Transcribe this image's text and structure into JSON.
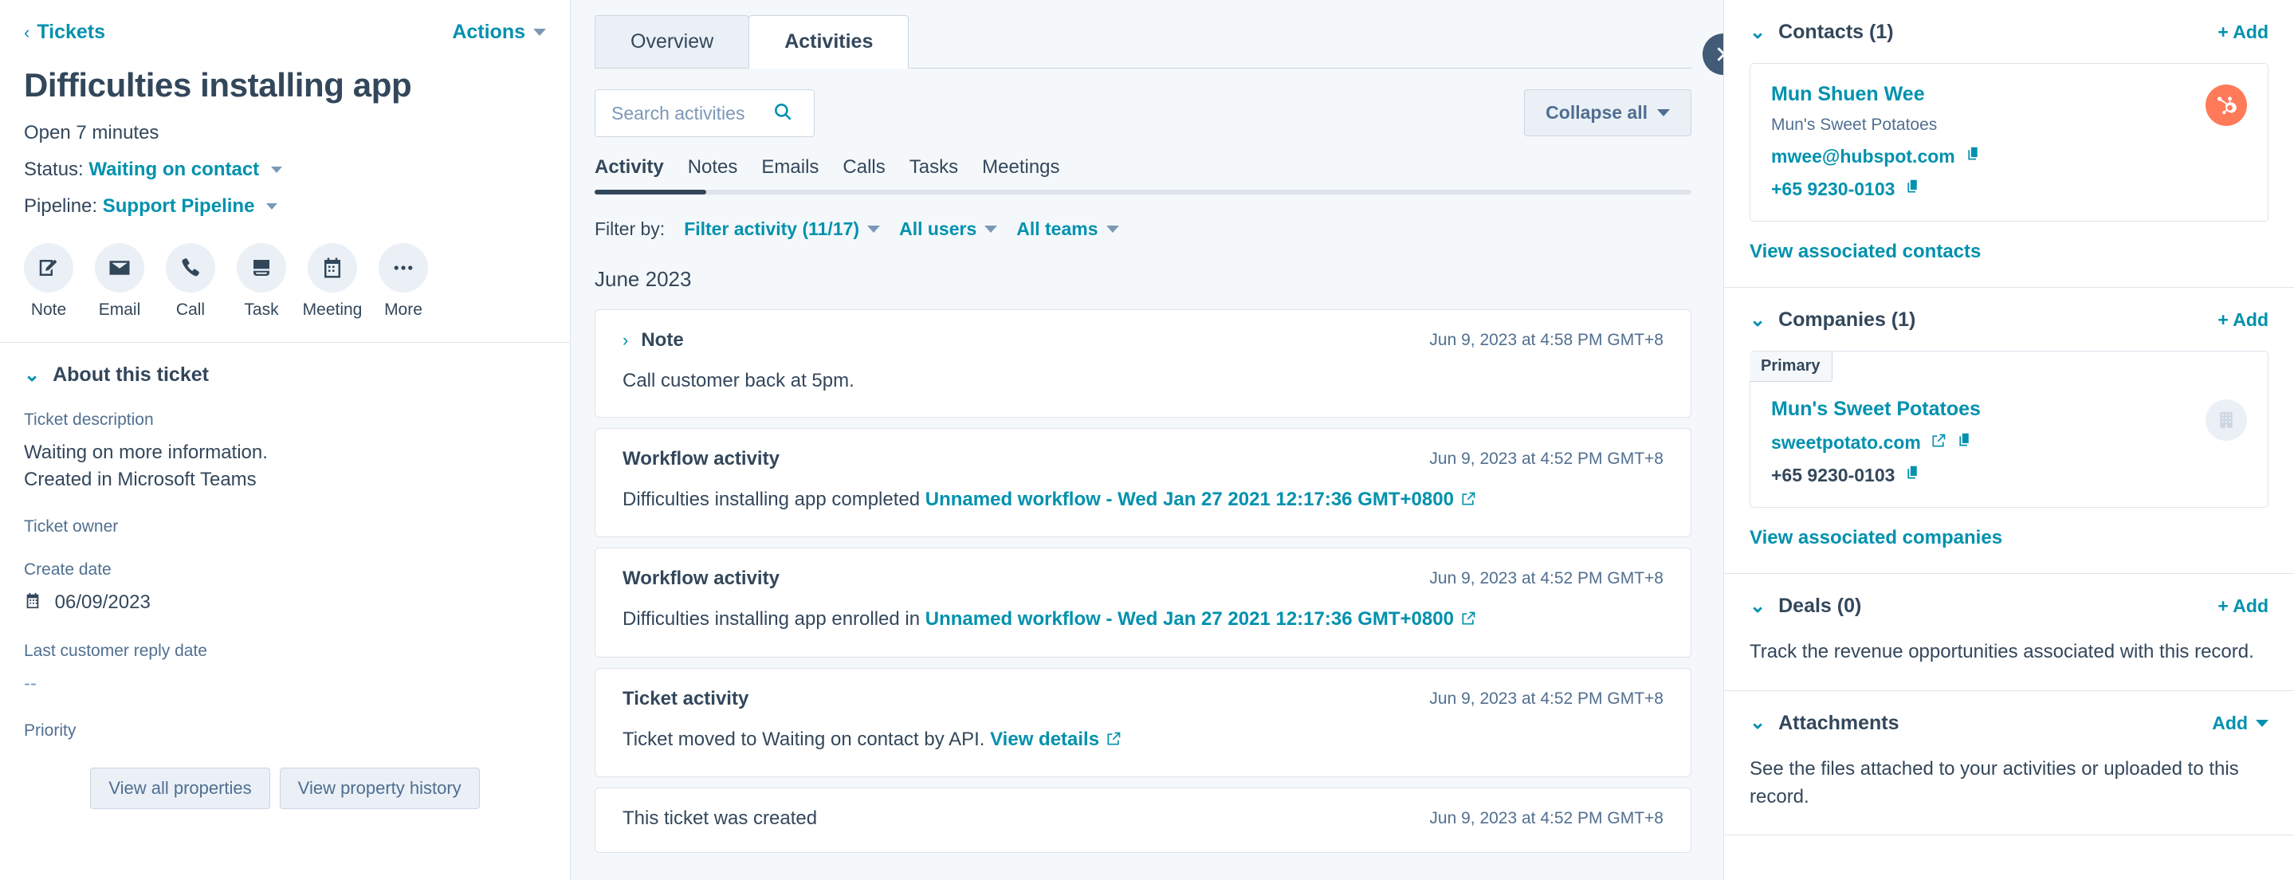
{
  "left": {
    "breadcrumb": "Tickets",
    "actions_label": "Actions",
    "title": "Difficulties installing app",
    "open_duration": "Open 7 minutes",
    "status_label": "Status:",
    "status_value": "Waiting on contact",
    "pipeline_label": "Pipeline:",
    "pipeline_value": "Support Pipeline",
    "quick_actions": [
      {
        "label": "Note",
        "icon": "note-icon"
      },
      {
        "label": "Email",
        "icon": "email-icon"
      },
      {
        "label": "Call",
        "icon": "call-icon"
      },
      {
        "label": "Task",
        "icon": "task-icon"
      },
      {
        "label": "Meeting",
        "icon": "meeting-icon"
      },
      {
        "label": "More",
        "icon": "more-icon"
      }
    ],
    "about_title": "About this ticket",
    "properties": [
      {
        "label": "Ticket description",
        "value": "Waiting on more information.\nCreated in Microsoft Teams"
      },
      {
        "label": "Ticket owner",
        "value": ""
      },
      {
        "label": "Create date",
        "value": "06/09/2023"
      },
      {
        "label": "Last customer reply date",
        "value": "--"
      },
      {
        "label": "Priority",
        "value": ""
      }
    ],
    "view_all_properties": "View all properties",
    "view_property_history": "View property history"
  },
  "center": {
    "top_tabs": [
      {
        "label": "Overview",
        "active": false
      },
      {
        "label": "Activities",
        "active": true
      }
    ],
    "search": {
      "placeholder": "Search activities",
      "value": ""
    },
    "collapse_all": "Collapse all",
    "sub_tabs": [
      {
        "label": "Activity",
        "active": true
      },
      {
        "label": "Notes",
        "active": false
      },
      {
        "label": "Emails",
        "active": false
      },
      {
        "label": "Calls",
        "active": false
      },
      {
        "label": "Tasks",
        "active": false
      },
      {
        "label": "Meetings",
        "active": false
      }
    ],
    "filter_lead": "Filter by:",
    "filters": [
      {
        "label": "Filter activity (11/17)"
      },
      {
        "label": "All users"
      },
      {
        "label": "All teams"
      }
    ],
    "month_heading": "June 2023",
    "cards": [
      {
        "kind": "note",
        "title": "Note",
        "timestamp": "Jun 9, 2023 at 4:58 PM GMT+8",
        "body_pre": "Call customer back at 5pm.",
        "link": "",
        "body_post": ""
      },
      {
        "kind": "workflow",
        "title": "Workflow activity",
        "timestamp": "Jun 9, 2023 at 4:52 PM GMT+8",
        "body_pre": "Difficulties installing app completed ",
        "link": "Unnamed workflow - Wed Jan 27 2021 12:17:36 GMT+0800",
        "body_post": ""
      },
      {
        "kind": "workflow",
        "title": "Workflow activity",
        "timestamp": "Jun 9, 2023 at 4:52 PM GMT+8",
        "body_pre": "Difficulties installing app enrolled in ",
        "link": "Unnamed workflow - Wed Jan 27 2021 12:17:36 GMT+0800",
        "body_post": ""
      },
      {
        "kind": "ticket",
        "title": "Ticket activity",
        "timestamp": "Jun 9, 2023 at 4:52 PM GMT+8",
        "body_pre": "Ticket moved to Waiting on contact by API. ",
        "link": "View details",
        "body_post": ""
      },
      {
        "kind": "simple",
        "title": "This ticket was created",
        "timestamp": "Jun 9, 2023 at 4:52 PM GMT+8",
        "body_pre": "",
        "link": "",
        "body_post": ""
      }
    ]
  },
  "right": {
    "contacts": {
      "title": "Contacts (1)",
      "add_label": "+ Add",
      "name": "Mun Shuen Wee",
      "company": "Mun's Sweet Potatoes",
      "email": "mwee@hubspot.com",
      "phone": "+65 9230-0103",
      "view_link": "View associated contacts"
    },
    "companies": {
      "title": "Companies (1)",
      "add_label": "+ Add",
      "badge": "Primary",
      "name": "Mun's Sweet Potatoes",
      "domain": "sweetpotato.com",
      "phone": "+65 9230-0103",
      "view_link": "View associated companies"
    },
    "deals": {
      "title": "Deals (0)",
      "add_label": "+ Add",
      "empty_text": "Track the revenue opportunities associated with this record."
    },
    "attachments": {
      "title": "Attachments",
      "add_label": "Add",
      "empty_text": "See the files attached to your activities or uploaded to this record."
    }
  },
  "colors": {
    "accent_teal": "#0091ae",
    "text_dark": "#33475b",
    "brand_orange": "#ff7a59",
    "page_bg": "#f5f8fa"
  }
}
